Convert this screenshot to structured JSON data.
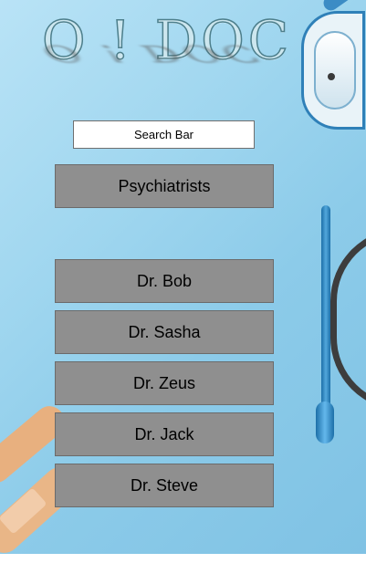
{
  "logo": {
    "text": "O ! DOC"
  },
  "search": {
    "placeholder": "Search Bar"
  },
  "category": {
    "label": "Psychiatrists"
  },
  "doctors": [
    {
      "label": "Dr. Bob"
    },
    {
      "label": "Dr. Sasha"
    },
    {
      "label": "Dr. Zeus"
    },
    {
      "label": "Dr. Jack"
    },
    {
      "label": "Dr. Steve"
    }
  ],
  "colors": {
    "background": "#9fd6ef",
    "button": "#8f8f8f",
    "button_border": "#6b6b6b"
  }
}
